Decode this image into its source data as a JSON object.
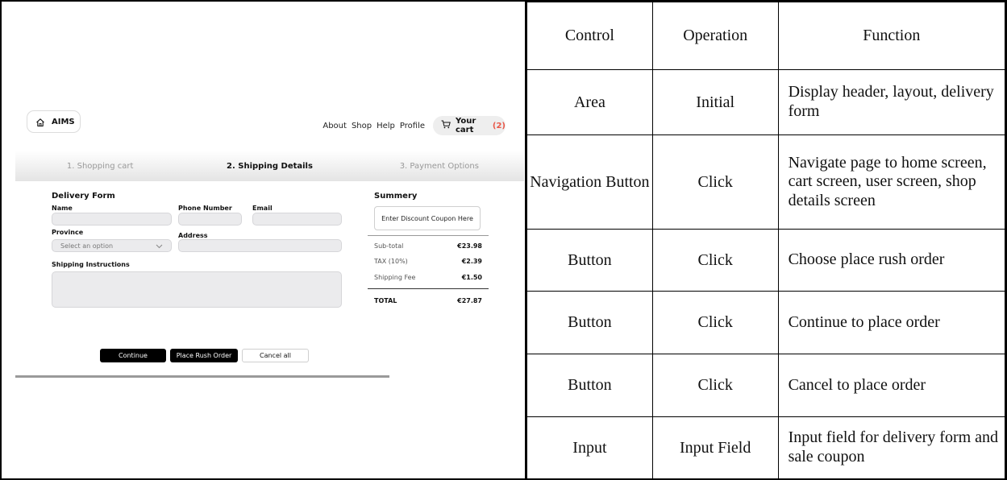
{
  "header": {
    "logo_text": "AIMS",
    "nav": [
      "About",
      "Shop",
      "Help",
      "Profile"
    ],
    "cart_label": "Your cart",
    "cart_count": "(2)"
  },
  "steps": [
    "1. Shopping cart",
    "2. Shipping Details",
    "3. Payment Options"
  ],
  "active_step": 1,
  "form": {
    "title": "Delivery Form",
    "name_label": "Name",
    "phone_label": "Phone Number",
    "email_label": "Email",
    "province_label": "Province",
    "province_value": "Select an option",
    "address_label": "Address",
    "instructions_label": "Shipping Instructions"
  },
  "summary": {
    "title": "Summery",
    "coupon_placeholder": "Enter Discount Coupon Here",
    "rows": [
      {
        "label": "Sub-total",
        "value": "€23.98"
      },
      {
        "label": "TAX (10%)",
        "value": "€2.39"
      },
      {
        "label": "Shipping Fee",
        "value": "€1.50"
      }
    ],
    "total_label": "TOTAL",
    "total_value": "€27.87"
  },
  "buttons": {
    "continue": "Continue",
    "rush": "Place Rush Order",
    "cancel": "Cancel all"
  },
  "table": {
    "headers": [
      "Control",
      "Operation",
      "Function"
    ],
    "rows": [
      [
        "Area",
        "Initial",
        "Display header, layout, delivery form"
      ],
      [
        "Navigation Button",
        "Click",
        "Navigate page to home screen, cart screen, user screen, shop details screen"
      ],
      [
        "Button",
        "Click",
        "Choose place rush order"
      ],
      [
        "Button",
        "Click",
        "Continue to place order"
      ],
      [
        "Button",
        "Click",
        "Cancel to place order"
      ],
      [
        "Input",
        "Input Field",
        "Input field for delivery form and sale coupon"
      ]
    ]
  },
  "colors": {
    "cart_count": "#e9594a",
    "input_bg": "#ebebed",
    "dark_button": "#000000"
  }
}
